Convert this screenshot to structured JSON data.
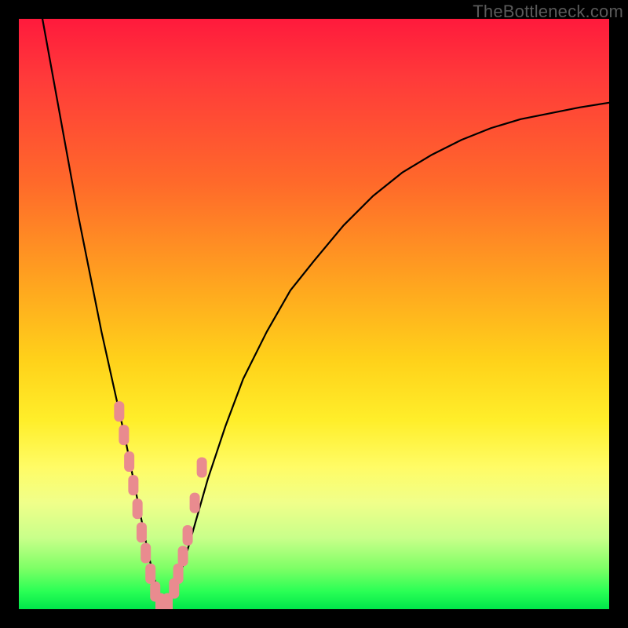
{
  "watermark": "TheBottleneck.com",
  "colors": {
    "curve_stroke": "#000000",
    "marker_fill": "#e98b8f",
    "marker_stroke": "#d77a80"
  },
  "chart_data": {
    "type": "line",
    "title": "",
    "xlabel": "",
    "ylabel": "",
    "xlim": [
      0,
      100
    ],
    "ylim": [
      0,
      100
    ],
    "series": [
      {
        "name": "bottleneck-curve",
        "x": [
          4,
          6,
          8,
          10,
          12,
          14,
          16,
          18,
          19,
          20,
          21,
          22,
          23,
          24,
          25,
          26,
          28,
          30,
          32,
          35,
          38,
          42,
          46,
          50,
          55,
          60,
          65,
          70,
          75,
          80,
          85,
          90,
          95,
          100
        ],
        "y": [
          100,
          89,
          78,
          67,
          57,
          47,
          38,
          29,
          24,
          19,
          14,
          9,
          5,
          2,
          0,
          2,
          8,
          15,
          22,
          31,
          39,
          47,
          54,
          59,
          65,
          70,
          74,
          77,
          79.5,
          81.5,
          83,
          84,
          85,
          85.8
        ]
      }
    ],
    "markers": {
      "name": "highlighted-points",
      "x": [
        17.0,
        17.8,
        18.7,
        19.4,
        20.1,
        20.8,
        21.5,
        22.3,
        23.1,
        24.0,
        25.2,
        26.3,
        27.0,
        27.8,
        28.6,
        29.8,
        31.0
      ],
      "y": [
        33.5,
        29.5,
        25.0,
        21.0,
        17.0,
        13.0,
        9.5,
        6.0,
        3.0,
        1.0,
        1.0,
        3.5,
        6.0,
        9.0,
        12.5,
        18.0,
        24.0
      ]
    }
  }
}
